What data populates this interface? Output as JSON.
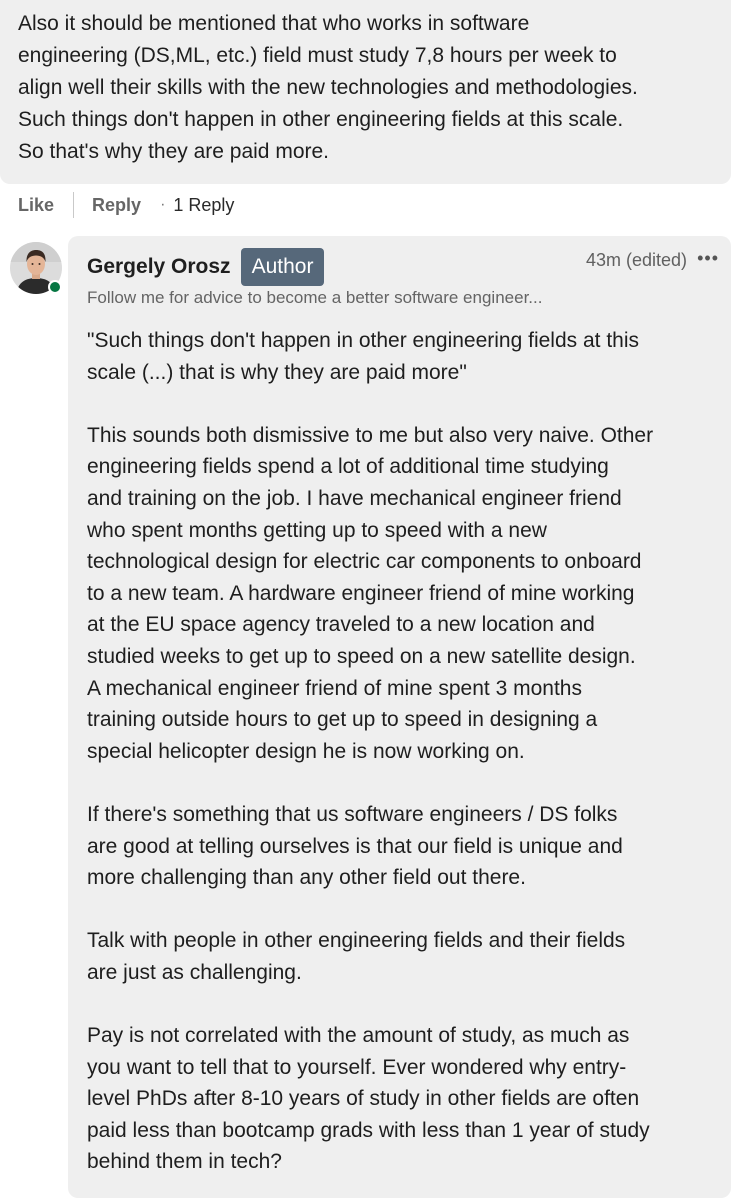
{
  "parent_comment": {
    "text": "Also it should be mentioned that who works in software\nengineering (DS,ML, etc.) field must study 7,8 hours per week to\nalign well their skills with the new technologies and methodologies.\nSuch things don't happen in other engineering fields at this scale.\nSo that's why they are paid more."
  },
  "actions": {
    "like_label": "Like",
    "reply_label": "Reply",
    "separator": "·",
    "reply_count": "1 Reply"
  },
  "reply": {
    "author_name": "Gergely Orosz",
    "author_badge": "Author",
    "timestamp": "43m (edited)",
    "more_label": "•••",
    "headline": "Follow me for advice to become a better software engineer...",
    "paragraphs": [
      "\"Such things don't happen in other engineering fields at this\nscale (...) that is why they are paid more\"",
      "This sounds both dismissive to me but also very naive. Other\nengineering fields spend a lot of additional time studying\nand training on the job. I have mechanical engineer friend\nwho spent months getting up to speed with a new\ntechnological design for electric car components to onboard\nto a new team. A hardware engineer friend of mine working\nat the EU space agency traveled to a new location and\nstudied weeks to get up to speed on a new satellite design.\nA mechanical engineer friend of mine spent 3 months\ntraining outside hours to get up to speed in designing a\nspecial helicopter design he is now working on.",
      "If there's something that us software engineers / DS folks\nare good at telling ourselves is that our field is unique and\nmore challenging than any other field out there.",
      "Talk with people in other engineering fields and their fields\nare just as challenging.",
      "Pay is not correlated with the amount of study, as much as\nyou want to tell that to yourself. Ever wondered why entry-\nlevel PhDs after 8-10 years of study in other fields are often\npaid less than bootcamp grads with less than 1 year of study\nbehind them in tech?"
    ]
  },
  "colors": {
    "bubble_bg": "#efefef",
    "badge_bg": "#56687a",
    "presence": "#057642"
  },
  "icons": {
    "avatar": "avatar-photo",
    "presence": "online-status-icon",
    "more": "more-options-icon"
  }
}
